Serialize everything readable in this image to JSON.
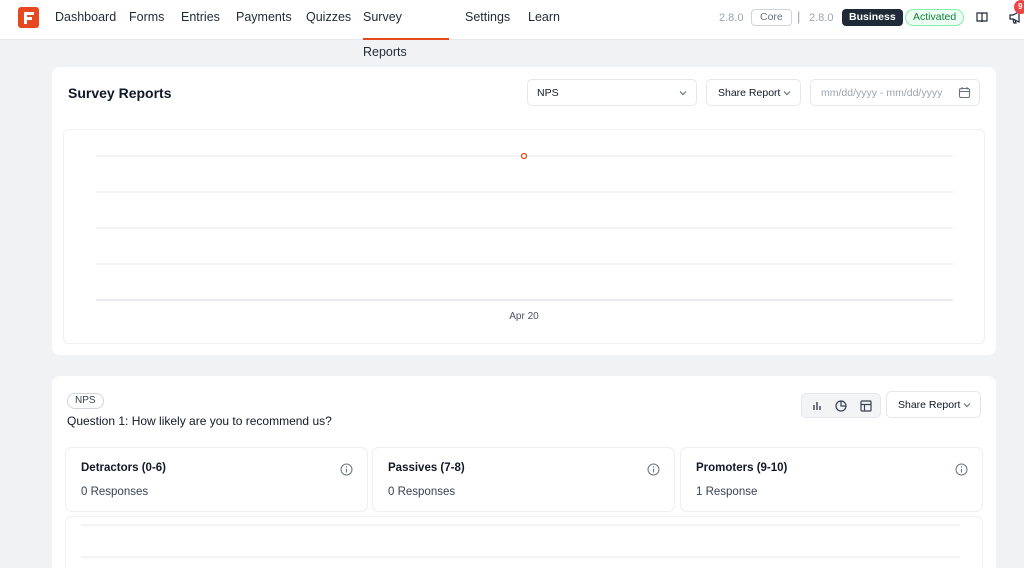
{
  "nav": {
    "items": [
      "Dashboard",
      "Forms",
      "Entries",
      "Payments",
      "Quizzes",
      "Survey Reports",
      "Settings",
      "Learn"
    ],
    "active": "Survey Reports",
    "version_core": "2.8.0",
    "core_label": "Core",
    "version_business": "2.8.0",
    "business_label": "Business",
    "status_label": "Activated",
    "notification_count": "9",
    "icons": [
      "formidable-logo",
      "book-icon",
      "megaphone-icon"
    ],
    "accent_color": "#e6491f"
  },
  "report": {
    "title": "Survey Reports",
    "form_select": "NPS",
    "share_label": "Share Report",
    "date_placeholder": "mm/dd/yyyy - mm/dd/yyyy",
    "chart": {
      "x_label": "Apr 20",
      "point_color": "#e6491f"
    }
  },
  "question": {
    "chip": "NPS",
    "text": "Question 1: How likely are you to recommend us?",
    "share_label": "Share Report",
    "view_icons": [
      "bar-chart-icon",
      "pie-chart-icon",
      "table-icon"
    ],
    "categories": [
      {
        "title": "Detractors (0-6)",
        "value": "0 Responses"
      },
      {
        "title": "Passives (7-8)",
        "value": "0 Responses"
      },
      {
        "title": "Promoters (9-10)",
        "value": "1 Response"
      }
    ]
  }
}
